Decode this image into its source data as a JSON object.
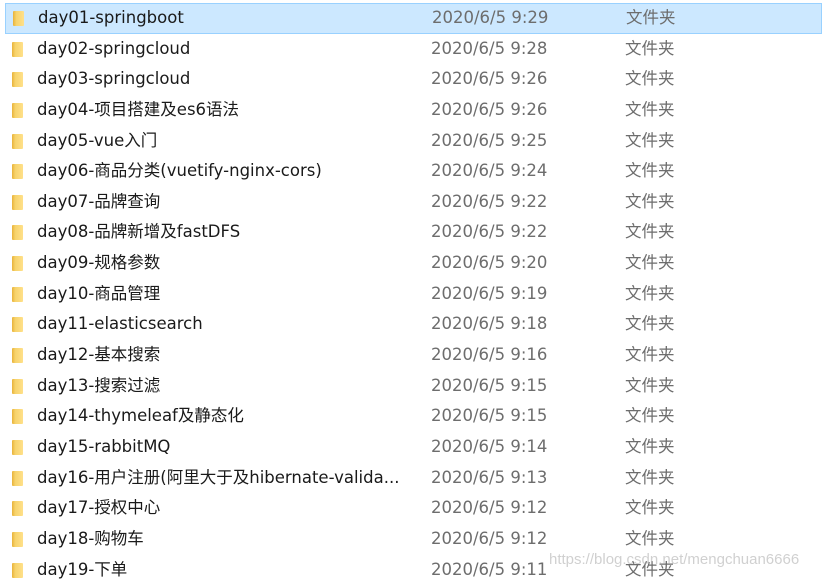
{
  "type_label": "文件夹",
  "selected_index": 0,
  "colors": {
    "selection_bg": "#cce8ff",
    "selection_border": "#99d1ff",
    "folder": "#f7d36b"
  },
  "rows": [
    {
      "name": "day01-springboot",
      "date": "2020/6/5 9:29",
      "type": "文件夹"
    },
    {
      "name": "day02-springcloud",
      "date": "2020/6/5 9:28",
      "type": "文件夹"
    },
    {
      "name": "day03-springcloud",
      "date": "2020/6/5 9:26",
      "type": "文件夹"
    },
    {
      "name": "day04-项目搭建及es6语法",
      "date": "2020/6/5 9:26",
      "type": "文件夹"
    },
    {
      "name": "day05-vue入门",
      "date": "2020/6/5 9:25",
      "type": "文件夹"
    },
    {
      "name": "day06-商品分类(vuetify-nginx-cors)",
      "date": "2020/6/5 9:24",
      "type": "文件夹"
    },
    {
      "name": "day07-品牌查询",
      "date": "2020/6/5 9:22",
      "type": "文件夹"
    },
    {
      "name": "day08-品牌新增及fastDFS",
      "date": "2020/6/5 9:22",
      "type": "文件夹"
    },
    {
      "name": "day09-规格参数",
      "date": "2020/6/5 9:20",
      "type": "文件夹"
    },
    {
      "name": "day10-商品管理",
      "date": "2020/6/5 9:19",
      "type": "文件夹"
    },
    {
      "name": "day11-elasticsearch",
      "date": "2020/6/5 9:18",
      "type": "文件夹"
    },
    {
      "name": "day12-基本搜索",
      "date": "2020/6/5 9:16",
      "type": "文件夹"
    },
    {
      "name": "day13-搜索过滤",
      "date": "2020/6/5 9:15",
      "type": "文件夹"
    },
    {
      "name": "day14-thymeleaf及静态化",
      "date": "2020/6/5 9:15",
      "type": "文件夹"
    },
    {
      "name": "day15-rabbitMQ",
      "date": "2020/6/5 9:14",
      "type": "文件夹"
    },
    {
      "name": "day16-用户注册(阿里大于及hibernate-valida...",
      "date": "2020/6/5 9:13",
      "type": "文件夹"
    },
    {
      "name": "day17-授权中心",
      "date": "2020/6/5 9:12",
      "type": "文件夹"
    },
    {
      "name": "day18-购物车",
      "date": "2020/6/5 9:12",
      "type": "文件夹"
    },
    {
      "name": "day19-下单",
      "date": "2020/6/5 9:11",
      "type": "文件夹"
    }
  ],
  "watermark": "https://blog.csdn.net/mengchuan6666"
}
